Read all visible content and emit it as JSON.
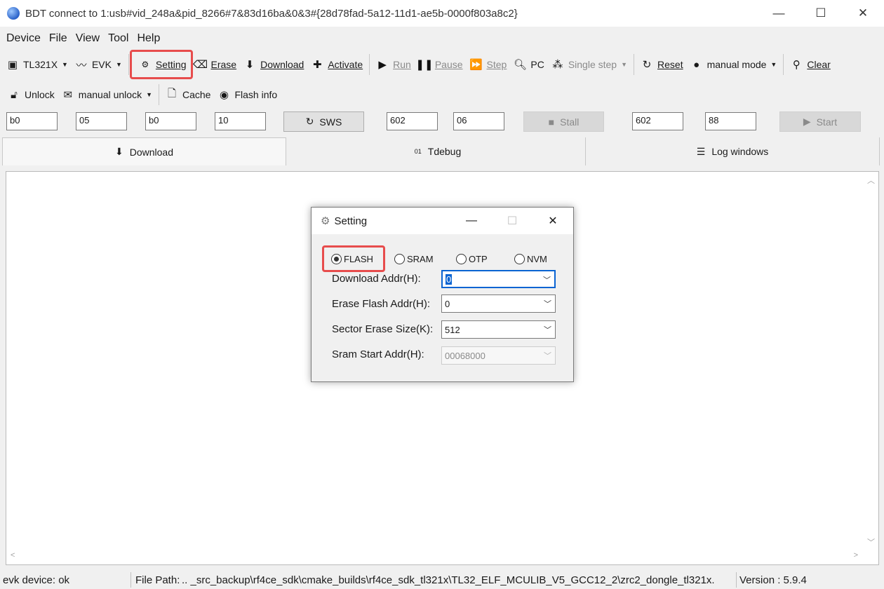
{
  "window": {
    "title": "BDT connect to 1:usb#vid_248a&pid_8266#7&83d16ba&0&3#{28d78fad-5a12-11d1-ae5b-0000f803a8c2}",
    "minimize": "—",
    "maximize": "☐",
    "close": "✕"
  },
  "menu": [
    "Device",
    "File",
    "View",
    "Tool",
    "Help"
  ],
  "toolbar1": {
    "chip": "TL321X",
    "board": "EVK",
    "setting": "Setting",
    "erase": "Erase",
    "download": "Download",
    "activate": "Activate",
    "run": "Run",
    "pause": "Pause",
    "step": "Step",
    "pc": "PC",
    "single_step": "Single step",
    "reset": "Reset",
    "manual_mode": "manual mode",
    "clear": "Clear"
  },
  "toolbar2": {
    "unlock": "Unlock",
    "manual_unlock": "manual unlock",
    "cache": "Cache",
    "flash_info": "Flash info"
  },
  "inputs_row": {
    "f1": "b0",
    "f2": "05",
    "f3": "b0",
    "f4": "10",
    "sws": "SWS",
    "f5": "602",
    "f6": "06",
    "stall": "Stall",
    "f7": "602",
    "f8": "88",
    "start": "Start"
  },
  "tabs": [
    "Download",
    "Tdebug",
    "Log windows"
  ],
  "status": {
    "device": "evk device: ok",
    "file_path_label": "File Path:",
    "file_path": "..  _src_backup\\rf4ce_sdk\\cmake_builds\\rf4ce_sdk_tl321x\\TL32_ELF_MCULIB_V5_GCC12_2\\zrc2_dongle_tl321x.",
    "version": "Version : 5.9.4"
  },
  "dialog": {
    "title": "Setting",
    "radios": [
      "FLASH",
      "SRAM",
      "OTP",
      "NVM"
    ],
    "selected_radio": "FLASH",
    "download_addr_label": "Download  Addr(H):",
    "download_addr": "0",
    "erase_addr_label": "Erase Flash Addr(H):",
    "erase_addr": "0",
    "sector_size_label": "Sector Erase Size(K):",
    "sector_size": "512",
    "sram_addr_label": "Sram Start Addr(H):",
    "sram_addr": "00068000"
  },
  "colors": {
    "highlight": "#e74c4c",
    "focus": "#0a64d2"
  }
}
